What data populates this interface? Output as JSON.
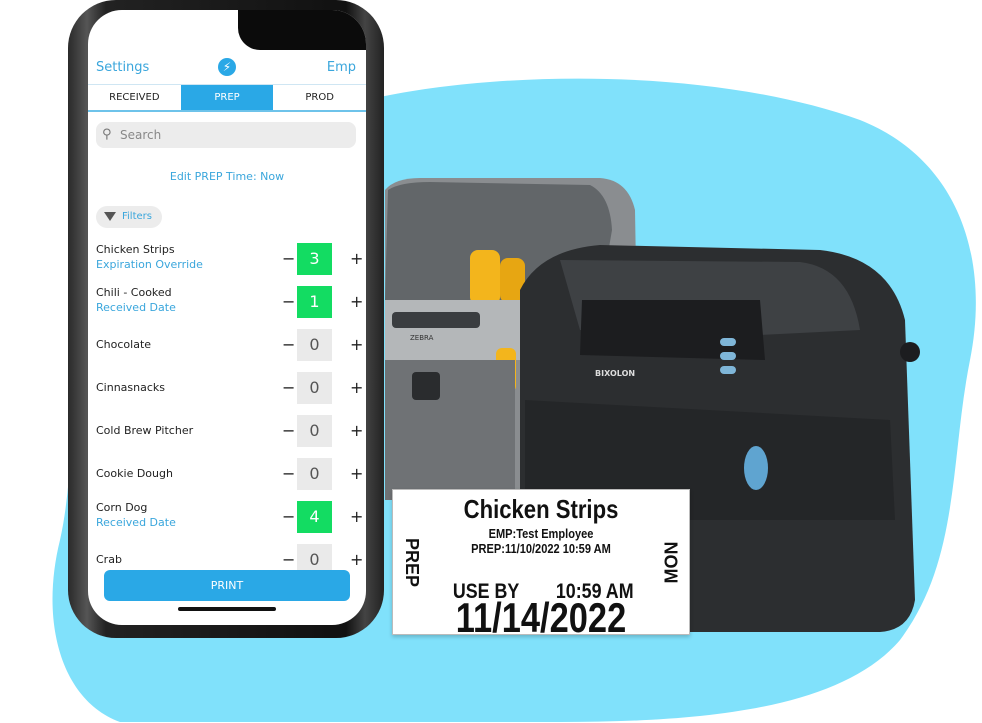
{
  "app": {
    "header_left": "Settings",
    "header_right": "Emp",
    "logo_icon": "bolt-logo-icon",
    "tabs": [
      {
        "label": "RECEIVED"
      },
      {
        "label": "PREP",
        "active": true
      },
      {
        "label": "PROD"
      }
    ],
    "search_placeholder": "Search",
    "edit_time": "Edit PREP Time: Now",
    "filters_label": "Filters",
    "items": [
      {
        "name": "Chicken Strips",
        "sub": "Expiration Override",
        "qty": "3",
        "active": true
      },
      {
        "name": "Chili - Cooked",
        "sub": "Received Date",
        "qty": "1",
        "active": true
      },
      {
        "name": "Chocolate",
        "sub": "",
        "qty": "0",
        "active": false
      },
      {
        "name": "Cinnasnacks",
        "sub": "",
        "qty": "0",
        "active": false
      },
      {
        "name": "Cold Brew Pitcher",
        "sub": "",
        "qty": "0",
        "active": false
      },
      {
        "name": "Cookie Dough",
        "sub": "",
        "qty": "0",
        "active": false
      },
      {
        "name": "Corn Dog",
        "sub": "Received Date",
        "qty": "4",
        "active": true
      },
      {
        "name": "Crab",
        "sub": "",
        "qty": "0",
        "active": false
      }
    ],
    "print_label": "PRINT"
  },
  "printers": {
    "left_brand": "ZEBRA",
    "right_brand": "BIXOLON"
  },
  "label": {
    "title": "Chicken Strips",
    "emp": "EMP:Test Employee",
    "prep": "PREP:11/10/2022 10:59 AM",
    "left_side": "PREP",
    "right_side": "MON",
    "use_by": "USE BY",
    "use_time": "10:59 AM",
    "use_date": "11/14/2022"
  },
  "colors": {
    "accent": "#2aa8e6",
    "active_qty": "#13dc62",
    "blob": "#80e1fb"
  }
}
